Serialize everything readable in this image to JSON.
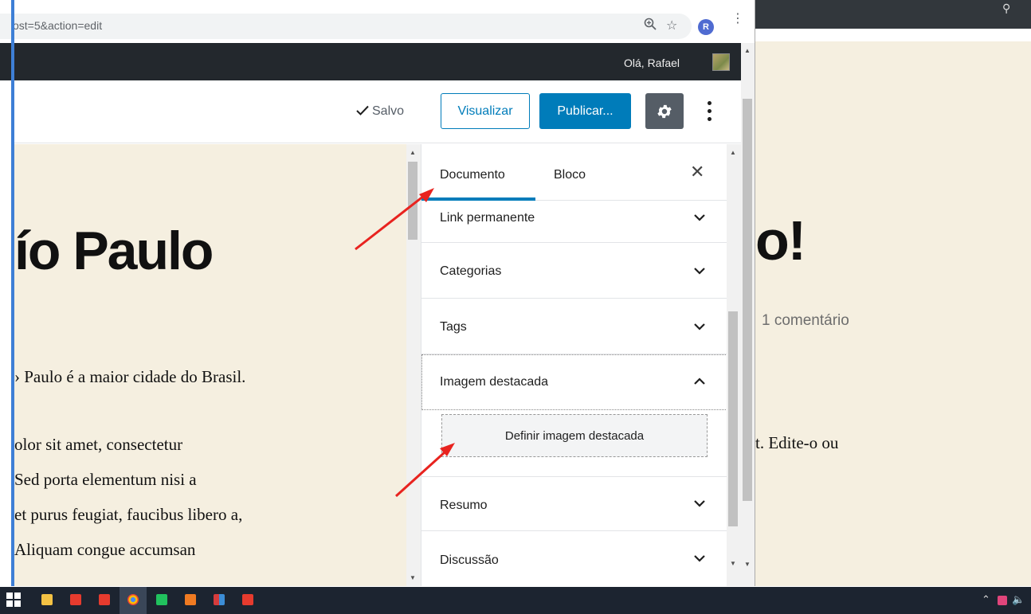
{
  "browser": {
    "url": "ost=5&action=edit",
    "profile_initial": "R"
  },
  "admin_bar": {
    "greeting": "Olá, Rafael"
  },
  "editor_header": {
    "saved_label": "Salvo",
    "preview_label": "Visualizar",
    "publish_label": "Publicar..."
  },
  "content": {
    "title": "ío Paulo",
    "paragraphs": [
      "› Paulo é a maior cidade do Brasil.",
      "olor sit amet, consectetur",
      "Sed porta elementum nisi a",
      " et purus feugiat, faucibus libero a,",
      "Aliquam congue accumsan"
    ]
  },
  "sidebar": {
    "tabs": [
      {
        "label": "Documento",
        "active": true
      },
      {
        "label": "Bloco",
        "active": false
      }
    ],
    "panels": [
      {
        "label": "Link permanente",
        "open": false
      },
      {
        "label": "Categorias",
        "open": false
      },
      {
        "label": "Tags",
        "open": false
      },
      {
        "label": "Imagem destacada",
        "open": true
      },
      {
        "label": "Resumo",
        "open": false
      },
      {
        "label": "Discussão",
        "open": false
      }
    ],
    "featured_button_label": "Definir imagem destacada"
  },
  "background_site": {
    "title_fragment": "o!",
    "comment_count": "1 comentário",
    "text_fragment": "t. Edite-o ou"
  },
  "colors": {
    "accent": "#007cba",
    "admin_bar": "#23282d",
    "content_bg": "#f5efe0",
    "annotation": "#e8231f"
  }
}
